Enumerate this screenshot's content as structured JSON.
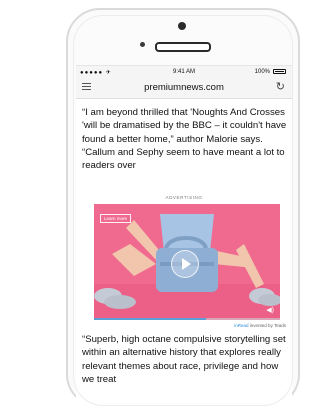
{
  "status_bar": {
    "carrier": "●●●●● ✈",
    "time": "9:41 AM",
    "battery": "100%"
  },
  "browser": {
    "url": "premiumnews.com",
    "menu_icon": "hamburger-icon",
    "reload_icon": "reload-icon"
  },
  "article": {
    "paragraph1": "“I am beyond thrilled that 'Noughts And Crosses 'will be dramatised by the BBC – it couldn't have found a better home,” author Malorie says. “Callum and Sephy seem to have meant a lot to readers over",
    "paragraph2": "“Superb, high octane compulsive storytelling set within an alternative history that explores really relevant themes about race, privilege and how we treat"
  },
  "ad": {
    "label": "ADVERTISING",
    "learn_more": "Learn more",
    "progress": 0.6,
    "background_color": "#f06a8f",
    "inread_brand": "inRead",
    "inread_suffix": " invented by Teads"
  }
}
